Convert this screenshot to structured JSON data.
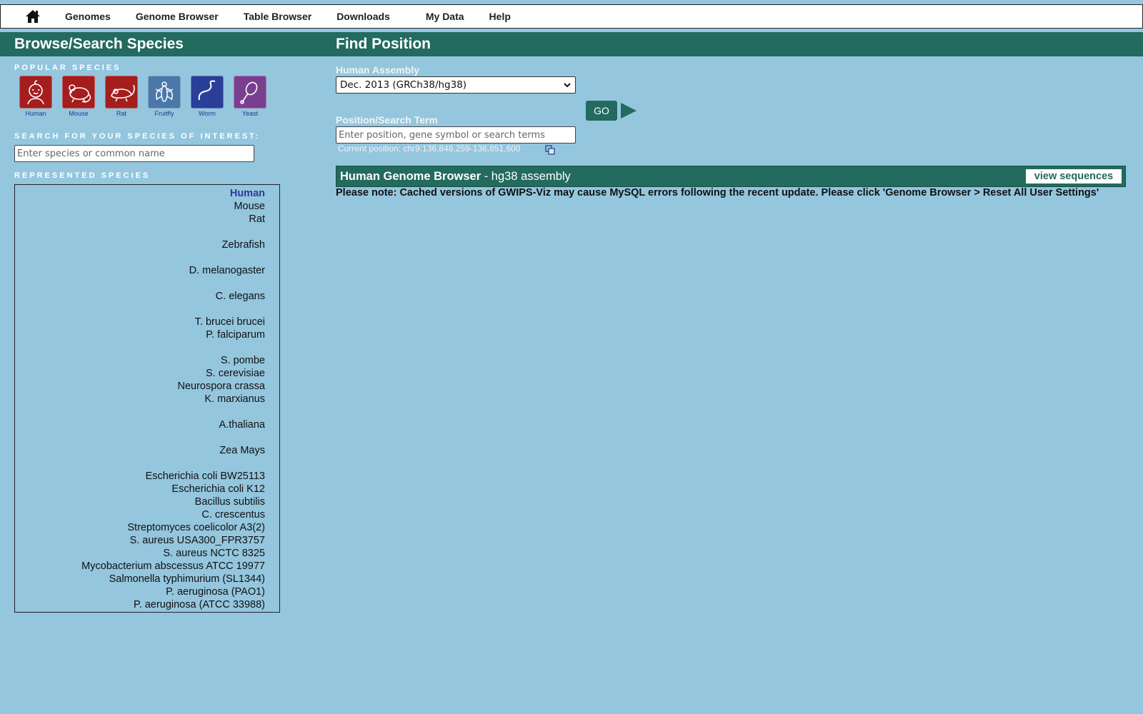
{
  "nav": {
    "items": [
      "Genomes",
      "Genome Browser",
      "Table Browser",
      "Downloads",
      "My Data",
      "Help"
    ]
  },
  "left": {
    "title": "Browse/Search Species",
    "popular_label": "POPULAR SPECIES",
    "popular": [
      {
        "label": "Human",
        "color": "#a51d1d",
        "icon": "human-icon"
      },
      {
        "label": "Mouse",
        "color": "#a51d1d",
        "icon": "mouse-icon"
      },
      {
        "label": "Rat",
        "color": "#a51d1d",
        "icon": "rat-icon"
      },
      {
        "label": "Fruitfly",
        "color": "#4a78a8",
        "icon": "fruitfly-icon"
      },
      {
        "label": "Worm",
        "color": "#2a3f99",
        "icon": "worm-icon"
      },
      {
        "label": "Yeast",
        "color": "#7a3e8f",
        "icon": "yeast-icon"
      }
    ],
    "search_label": "SEARCH FOR YOUR SPECIES OF INTEREST:",
    "search_placeholder": "Enter species or common name",
    "represented_label": "REPRESENTED SPECIES",
    "species": [
      {
        "name": "Human",
        "selected": true
      },
      {
        "name": "Mouse"
      },
      {
        "name": "Rat"
      },
      {
        "name": "Zebrafish"
      },
      {
        "name": "D. melanogaster"
      },
      {
        "name": "C. elegans"
      },
      {
        "name": "T. brucei brucei"
      },
      {
        "name": "P. falciparum"
      },
      {
        "name": "S. pombe"
      },
      {
        "name": "S. cerevisiae"
      },
      {
        "name": "Neurospora crassa"
      },
      {
        "name": "K. marxianus"
      },
      {
        "name": "A.thaliana"
      },
      {
        "name": "Zea Mays"
      },
      {
        "name": "Escherichia coli BW25113"
      },
      {
        "name": "Escherichia coli K12"
      },
      {
        "name": "Bacillus subtilis"
      },
      {
        "name": "C. crescentus"
      },
      {
        "name": "Streptomyces coelicolor A3(2)"
      },
      {
        "name": "S. aureus USA300_FPR3757"
      },
      {
        "name": "S. aureus NCTC 8325"
      },
      {
        "name": "Mycobacterium abscessus ATCC 19977"
      },
      {
        "name": "Salmonella typhimurium (SL1344)"
      },
      {
        "name": "P. aeruginosa (PAO1)"
      },
      {
        "name": "P. aeruginosa (ATCC 33988)"
      }
    ]
  },
  "right": {
    "title": "Find Position",
    "assembly_label": "Human Assembly",
    "assembly_value": "Dec. 2013 (GRCh38/hg38)",
    "position_label": "Position/Search Term",
    "position_placeholder": "Enter position, gene symbol or search terms",
    "go_label": "GO",
    "current_position": "Current position: chr9:136,848,259-136,851,600",
    "browser_title": "Human Genome Browser",
    "browser_subtitle": " - hg38 assembly",
    "view_sequences": "view sequences",
    "note": "Please note: Cached versions of GWIPS-Viz may cause MySQL errors following the recent update. Please click 'Genome Browser > Reset All User Settings'"
  },
  "colors": {
    "background": "#94c6de",
    "header_green": "#236a5f",
    "selected_species": "#2a3d9a"
  }
}
